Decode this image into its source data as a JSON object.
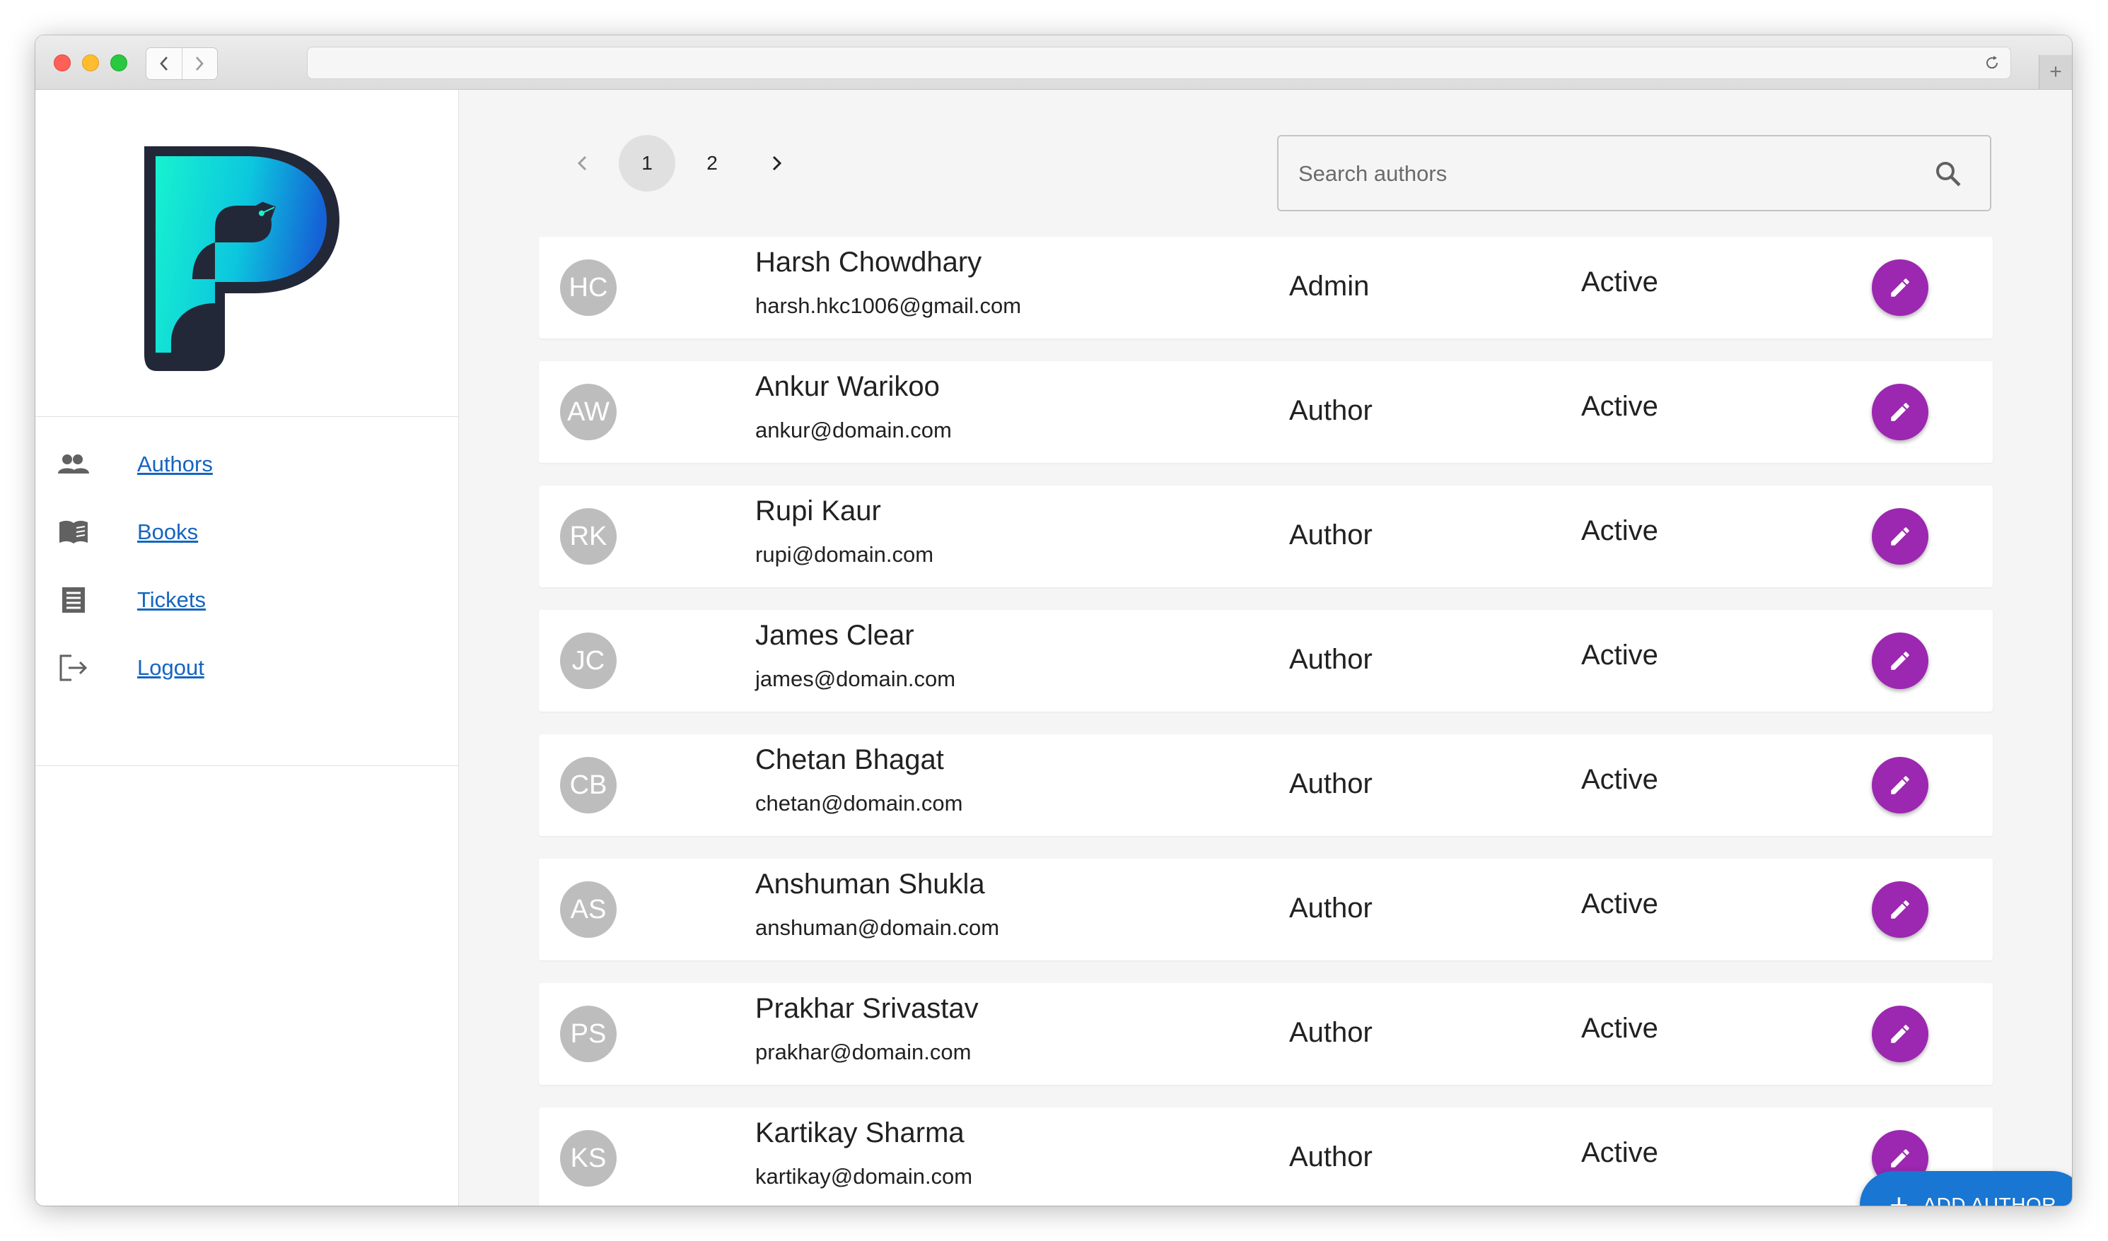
{
  "browser": {
    "url": ""
  },
  "sidebar": {
    "items": [
      {
        "label": "Authors",
        "icon": "people-icon"
      },
      {
        "label": "Books",
        "icon": "book-icon"
      },
      {
        "label": "Tickets",
        "icon": "ticket-icon"
      },
      {
        "label": "Logout",
        "icon": "logout-icon"
      }
    ]
  },
  "pagination": {
    "pages": [
      "1",
      "2"
    ],
    "current": "1"
  },
  "search": {
    "placeholder": "Search authors",
    "value": ""
  },
  "authors": [
    {
      "initials": "HC",
      "name": "Harsh Chowdhary",
      "email": "harsh.hkc1006@gmail.com",
      "role": "Admin",
      "status": "Active"
    },
    {
      "initials": "AW",
      "name": "Ankur Warikoo",
      "email": "ankur@domain.com",
      "role": "Author",
      "status": "Active"
    },
    {
      "initials": "RK",
      "name": "Rupi Kaur",
      "email": "rupi@domain.com",
      "role": "Author",
      "status": "Active"
    },
    {
      "initials": "JC",
      "name": "James Clear",
      "email": "james@domain.com",
      "role": "Author",
      "status": "Active"
    },
    {
      "initials": "CB",
      "name": "Chetan Bhagat",
      "email": "chetan@domain.com",
      "role": "Author",
      "status": "Active"
    },
    {
      "initials": "AS",
      "name": "Anshuman Shukla",
      "email": "anshuman@domain.com",
      "role": "Author",
      "status": "Active"
    },
    {
      "initials": "PS",
      "name": "Prakhar Srivastav",
      "email": "prakhar@domain.com",
      "role": "Author",
      "status": "Active"
    },
    {
      "initials": "KS",
      "name": "Kartikay Sharma",
      "email": "kartikay@domain.com",
      "role": "Author",
      "status": "Active"
    }
  ],
  "fab": {
    "label": "ADD AUTHOR"
  },
  "colors": {
    "accent": "#1976d2",
    "edit": "#9c27b0",
    "link": "#1565c0",
    "avatar": "#bdbdbd"
  }
}
